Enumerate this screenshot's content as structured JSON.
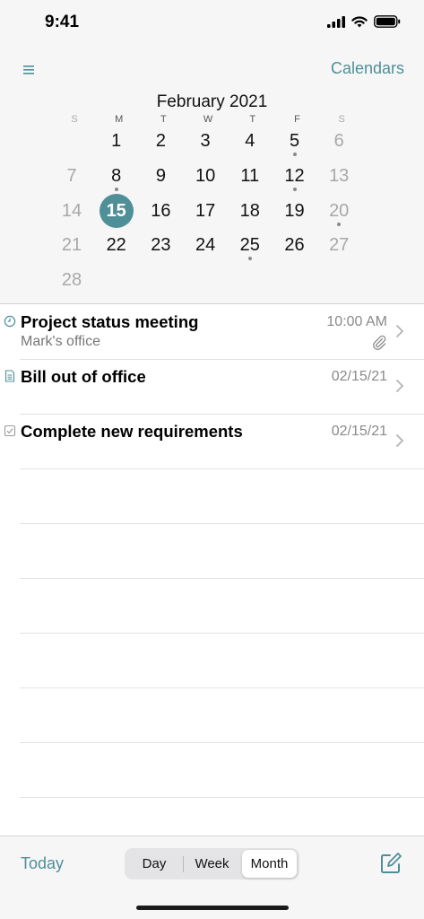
{
  "status_bar": {
    "time": "9:41"
  },
  "nav": {
    "calendars_label": "Calendars",
    "menu_icon": "hamburger-icon"
  },
  "calendar": {
    "month_title": "February 2021",
    "weekdays": [
      "S",
      "M",
      "T",
      "W",
      "T",
      "F",
      "S"
    ],
    "weeks": [
      [
        "",
        "1",
        "2",
        "3",
        "4",
        "5",
        "6"
      ],
      [
        "7",
        "8",
        "9",
        "10",
        "11",
        "12",
        "13"
      ],
      [
        "14",
        "15",
        "16",
        "17",
        "18",
        "19",
        "20"
      ],
      [
        "21",
        "22",
        "23",
        "24",
        "25",
        "26",
        "27"
      ],
      [
        "28",
        "",
        "",
        "",
        "",
        "",
        ""
      ]
    ],
    "selected_day": "15",
    "days_with_events": [
      "5",
      "8",
      "12",
      "20",
      "25"
    ]
  },
  "events": [
    {
      "icon": "clock-icon",
      "title": "Project status meeting",
      "subtitle": "Mark's office",
      "time": "10:00 AM",
      "has_attachment": true
    },
    {
      "icon": "note-icon",
      "title": "Bill out of office",
      "subtitle": "",
      "time": "02/15/21",
      "has_attachment": false
    },
    {
      "icon": "checkbox-icon",
      "title": "Complete new requirements",
      "subtitle": "",
      "time": "02/15/21",
      "has_attachment": false
    }
  ],
  "toolbar": {
    "today_label": "Today",
    "views": [
      "Day",
      "Week",
      "Month"
    ],
    "active_view": "Month",
    "compose_icon": "compose-icon"
  },
  "colors": {
    "accent": "#4f8f98",
    "background": "#f6f6f6"
  }
}
